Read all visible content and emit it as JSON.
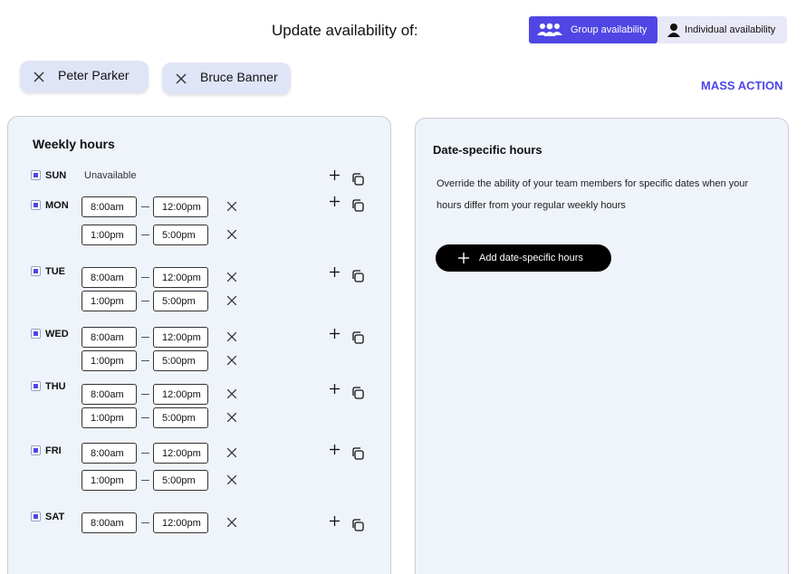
{
  "header": {
    "title": "Update availability of:"
  },
  "toggle": {
    "group_label": "Group availability",
    "individual_label": "Individual availability"
  },
  "chips": [
    {
      "name": "Peter Parker"
    },
    {
      "name": "Bruce Banner"
    }
  ],
  "mass_action": "MASS ACTION",
  "weekly": {
    "title": "Weekly hours",
    "days": [
      {
        "label": "SUN",
        "unavailable": "Unavailable",
        "slots": []
      },
      {
        "label": "MON",
        "slots": [
          {
            "start": "8:00am",
            "end": "12:00pm"
          },
          {
            "start": "1:00pm",
            "end": "5:00pm"
          }
        ]
      },
      {
        "label": "TUE",
        "slots": [
          {
            "start": "8:00am",
            "end": "12:00pm"
          },
          {
            "start": "1:00pm",
            "end": "5:00pm"
          }
        ]
      },
      {
        "label": "WED",
        "slots": [
          {
            "start": "8:00am",
            "end": "12:00pm"
          },
          {
            "start": "1:00pm",
            "end": "5:00pm"
          }
        ]
      },
      {
        "label": "THU",
        "slots": [
          {
            "start": "8:00am",
            "end": "12:00pm"
          },
          {
            "start": "1:00pm",
            "end": "5:00pm"
          }
        ]
      },
      {
        "label": "FRI",
        "slots": [
          {
            "start": "8:00am",
            "end": "12:00pm"
          },
          {
            "start": "1:00pm",
            "end": "5:00pm"
          }
        ]
      },
      {
        "label": "SAT",
        "slots": [
          {
            "start": "8:00am",
            "end": "12:00pm"
          }
        ]
      }
    ]
  },
  "date_specific": {
    "title": "Date-specific hours",
    "description_line1": "Override the ability of your team members for specific dates when your",
    "description_line2": "hours differ from your regular weekly hours",
    "add_button": "Add date-specific hours"
  },
  "colors": {
    "accent": "#4f46e5",
    "panel_bg": "#eff3fa",
    "chip_bg": "#e0e4f7"
  }
}
